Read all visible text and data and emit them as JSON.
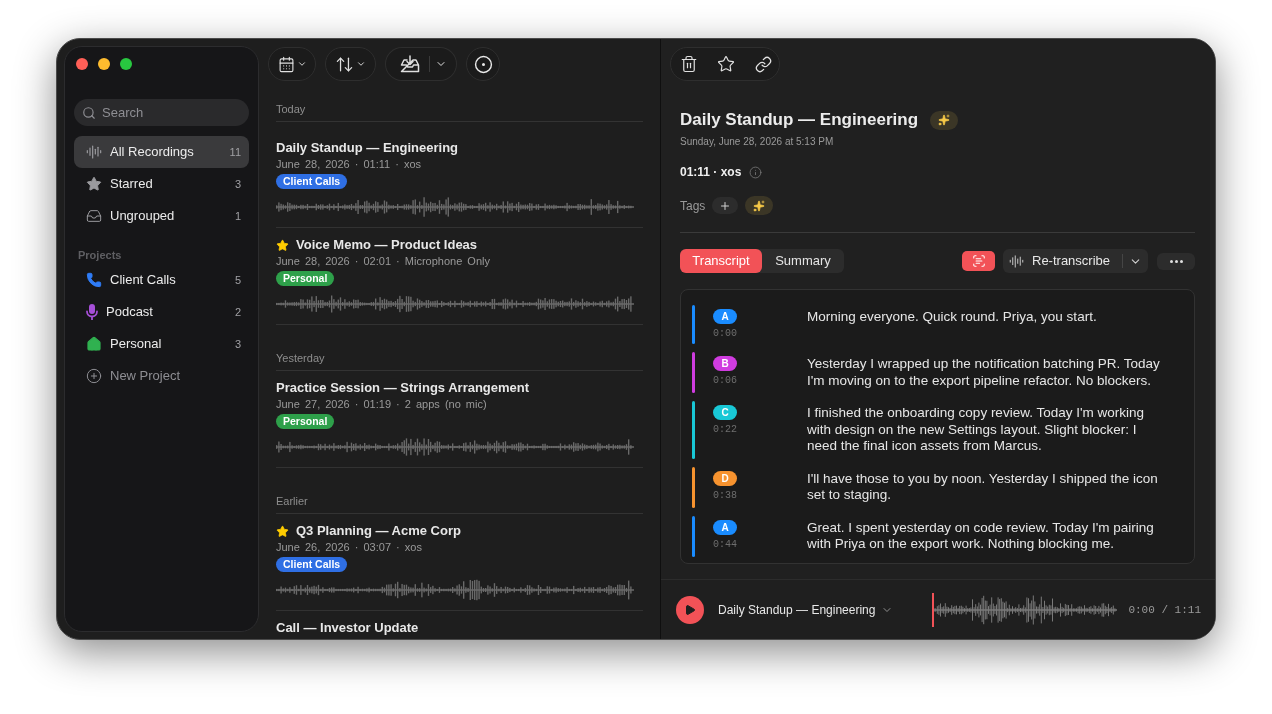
{
  "sidebar": {
    "search": {
      "placeholder": "Search"
    },
    "items": [
      {
        "label": "All Recordings",
        "count": "11",
        "selected": true
      },
      {
        "label": "Starred",
        "count": "3",
        "selected": false
      },
      {
        "label": "Ungrouped",
        "count": "1",
        "selected": false
      }
    ],
    "projects_heading": "Projects",
    "projects": [
      {
        "label": "Client Calls",
        "count": "5",
        "color": "#2f7cf6",
        "selected": false
      },
      {
        "label": "Podcast",
        "count": "2",
        "color": "#a64fd8",
        "selected": false
      },
      {
        "label": "Personal",
        "count": "3",
        "color": "#30b150",
        "selected": false
      }
    ],
    "new_project": "New Project"
  },
  "recordings": {
    "sections": [
      {
        "heading": "Today",
        "items": [
          {
            "title": "Daily Standup — Engineering",
            "starred": false,
            "meta": "June 28, 2026 · 01:11 · xos",
            "tag": {
              "label": "Client Calls",
              "color": "#2f6fe4"
            }
          },
          {
            "title": "Voice Memo — Product Ideas",
            "starred": true,
            "meta": "June 28, 2026 · 02:01 · Microphone Only",
            "tag": {
              "label": "Personal",
              "color": "#2ea04a"
            }
          }
        ]
      },
      {
        "heading": "Yesterday",
        "items": [
          {
            "title": "Practice Session — Strings Arrangement",
            "starred": false,
            "meta": "June 27, 2026 · 01:19 · 2 apps (no mic)",
            "tag": {
              "label": "Personal",
              "color": "#2ea04a"
            }
          }
        ]
      },
      {
        "heading": "Earlier",
        "items": [
          {
            "title": "Q3 Planning — Acme Corp",
            "starred": true,
            "meta": "June 26, 2026 · 03:07 · xos",
            "tag": {
              "label": "Client Calls",
              "color": "#2f6fe4"
            }
          },
          {
            "title": "Call — Investor Update",
            "starred": false
          }
        ]
      }
    ]
  },
  "detail": {
    "title": "Daily Standup — Engineering",
    "date": "Sunday, June 28, 2026 at 5:13 PM",
    "meta": "01:11 · xos",
    "tags_label": "Tags",
    "tabs": [
      {
        "label": "Transcript",
        "selected": true
      },
      {
        "label": "Summary",
        "selected": false
      }
    ],
    "retranscribe_label": "Re-transcribe",
    "transcript": [
      {
        "speaker": "A",
        "time": "0:00",
        "color": "#1a8cff",
        "text": "Morning everyone. Quick round. Priya, you start."
      },
      {
        "speaker": "B",
        "time": "0:06",
        "color": "#d03ce0",
        "text": "Yesterday I wrapped up the notification batching PR. Today I'm moving on to the export pipeline refactor. No blockers."
      },
      {
        "speaker": "C",
        "time": "0:22",
        "color": "#19c8d6",
        "text": "I finished the onboarding copy review. Today I'm working with design on the new Settings layout. Slight blocker: I need the final icon assets from Marcus."
      },
      {
        "speaker": "D",
        "time": "0:38",
        "color": "#f7932f",
        "text": "I'll have those to you by noon. Yesterday I shipped the icon set to staging."
      },
      {
        "speaker": "A",
        "time": "0:44",
        "color": "#1a8cff",
        "text": "Great. I spent yesterday on code review. Today I'm pairing with Priya on the export work. Nothing blocking me."
      }
    ]
  },
  "player": {
    "title": "Daily Standup — Engineering",
    "time": "0:00 / 1:11",
    "level": 0
  }
}
